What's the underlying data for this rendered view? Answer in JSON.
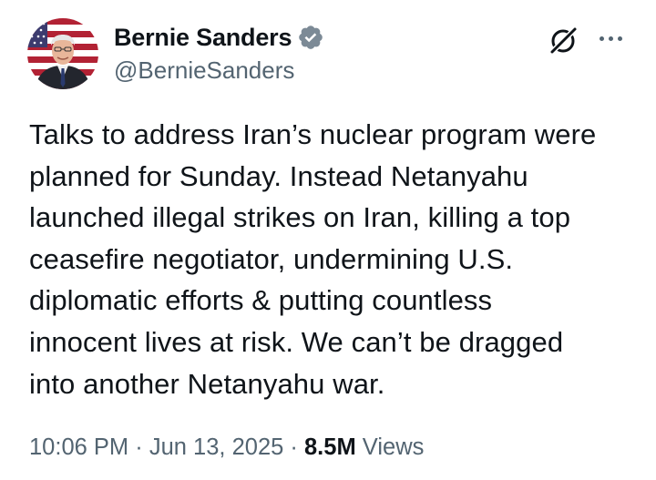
{
  "author": {
    "display_name": "Bernie Sanders",
    "handle": "@BernieSanders",
    "verified": true,
    "verified_color": "#1d9bf0"
  },
  "header_icons": {
    "grok": "grok-icon",
    "more": "more-icon"
  },
  "tweet": {
    "text": "Talks to address Iran’s nuclear program were\nplanned for Sunday. Instead Netanyahu\nlaunched illegal strikes on Iran, killing a top\nceasefire negotiator, undermining U.S.\ndiplomatic efforts & putting countless\ninnocent lives at risk. We can’t be dragged\ninto another Netanyahu war."
  },
  "meta": {
    "time": "10:06 PM",
    "separator": "·",
    "date": "Jun 13, 2025",
    "views_count": "8.5M",
    "views_label": "Views"
  },
  "colors": {
    "text_primary": "#0f1419",
    "text_secondary": "#536471",
    "background": "#ffffff"
  }
}
